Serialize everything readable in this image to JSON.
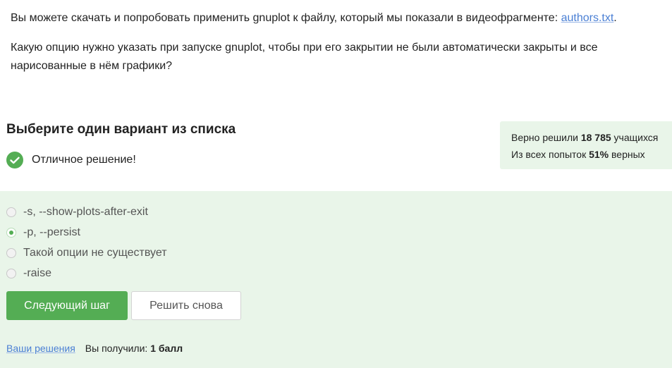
{
  "question": {
    "intro_text": "Вы можете скачать и попробовать применить gnuplot к файлу, который мы показали в видеофрагменте: ",
    "intro_link": "authors.txt",
    "intro_end": ".",
    "question_text": "Какую опцию нужно указать при запуске gnuplot, чтобы при его закрытии не были автоматически закрыты и все нарисованные в нём графики?"
  },
  "task": {
    "title": "Выберите один вариант из списка",
    "feedback": "Отличное решение!",
    "feedback_color": "#54ad54"
  },
  "stats": {
    "solved_prefix": "Верно решили ",
    "solved_count": "18 785",
    "solved_suffix": " учащихся",
    "attempts_prefix": "Из всех попыток ",
    "attempts_percent": "51%",
    "attempts_suffix": " верных"
  },
  "options": [
    {
      "label": "-s, --show-plots-after-exit",
      "selected": false
    },
    {
      "label": "-p, --persist",
      "selected": true
    },
    {
      "label": "Такой опции не существует",
      "selected": false
    },
    {
      "label": "-raise",
      "selected": false
    }
  ],
  "buttons": {
    "next": "Следующий шаг",
    "retry": "Решить снова"
  },
  "footer": {
    "solutions_link": "Ваши решения",
    "score_prefix": "Вы получили: ",
    "score_value": "1 балл"
  },
  "colors": {
    "accent": "#54ad54",
    "panel": "#e9f5e9",
    "link": "#4a7fd4"
  }
}
